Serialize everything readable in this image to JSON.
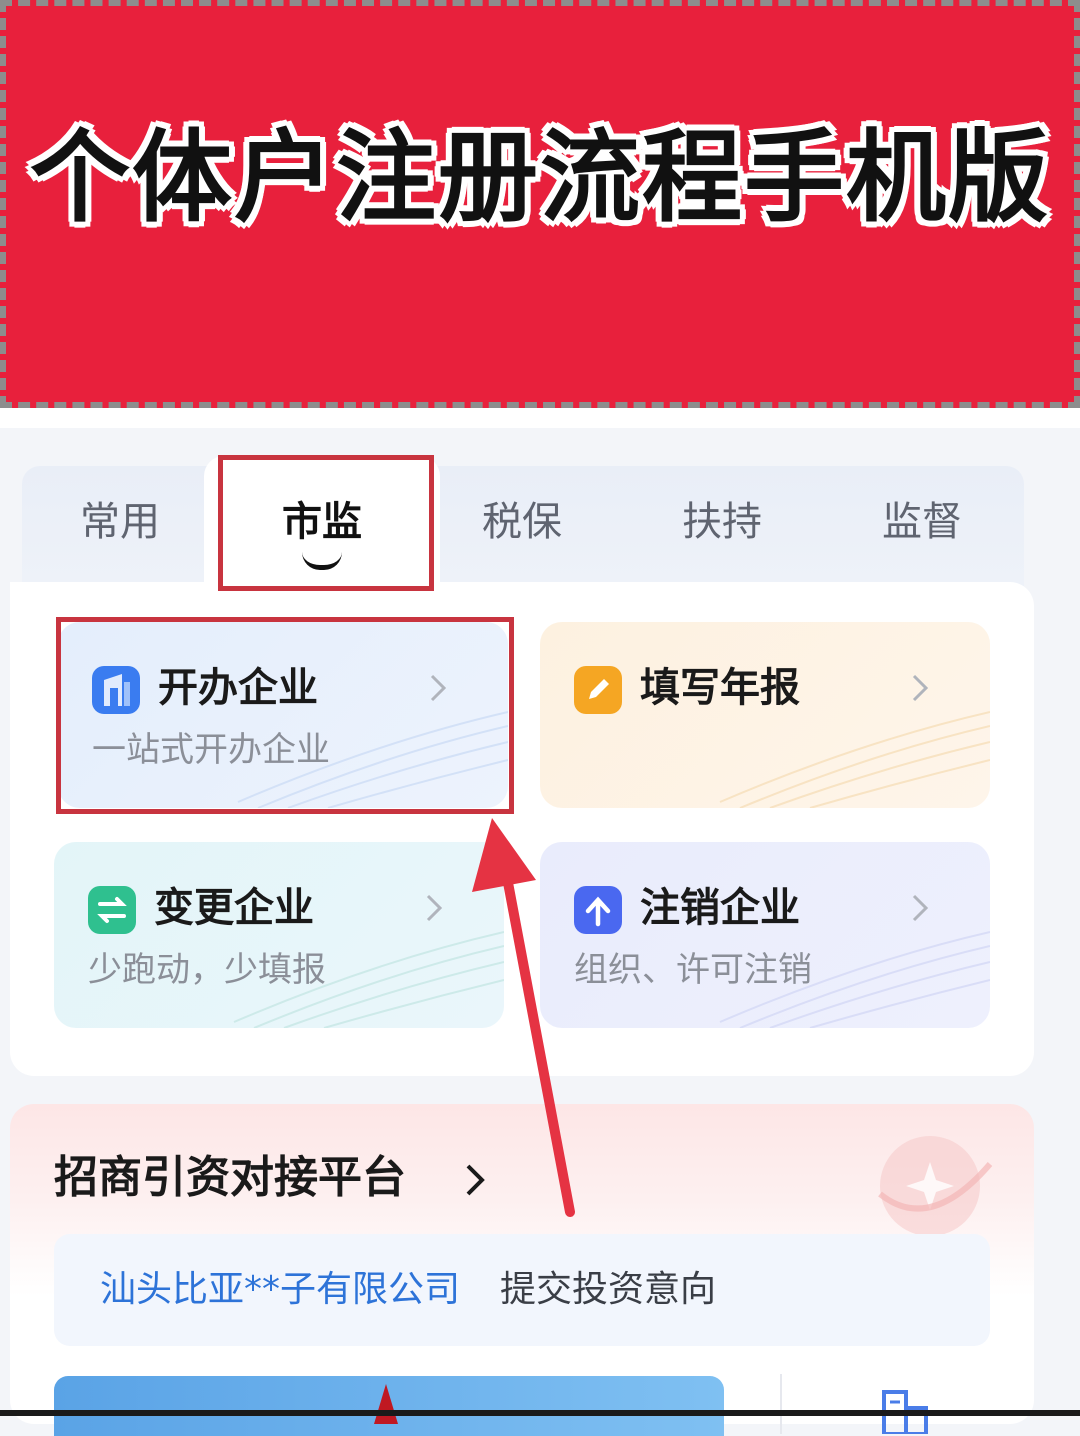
{
  "banner": {
    "title": "个体户注册流程手机版"
  },
  "tabs": [
    {
      "label": "常用",
      "active": false
    },
    {
      "label": "市监",
      "active": true
    },
    {
      "label": "税保",
      "active": false
    },
    {
      "label": "扶持",
      "active": false
    },
    {
      "label": "监督",
      "active": false
    }
  ],
  "services": {
    "open": {
      "title": "开办企业",
      "subtitle": "一站式开办企业",
      "icon": "building-door-icon",
      "color": "#3a7cf0"
    },
    "report": {
      "title": "填写年报",
      "subtitle": "",
      "icon": "pencil-icon",
      "color": "#f5a623"
    },
    "change": {
      "title": "变更企业",
      "subtitle": "少跑动，少填报",
      "icon": "swap-arrows-icon",
      "color": "#2fc08f"
    },
    "cancel": {
      "title": "注销企业",
      "subtitle": "组织、许可注销",
      "icon": "upload-arrow-icon",
      "color": "#4a68f0"
    }
  },
  "investment": {
    "title": "招商引资对接平台",
    "notice_company": "汕头比亚**子有限公司",
    "notice_action": "提交投资意向"
  },
  "colors": {
    "banner": "#e8203c",
    "highlight": "#c8343f",
    "link": "#2d73d8"
  }
}
